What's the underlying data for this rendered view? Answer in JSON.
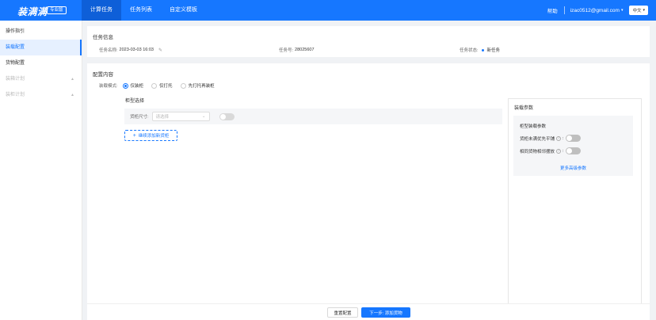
{
  "header": {
    "logo": "装满满",
    "edition": "专业版",
    "tabs": [
      {
        "label": "计算任务",
        "active": true
      },
      {
        "label": "任务列表",
        "active": false
      },
      {
        "label": "自定义模板",
        "active": false
      }
    ],
    "help": "帮助",
    "user_email": "izac0512@gmail.com",
    "language": "中文",
    "accent_color": "#1677ff"
  },
  "sidebar": {
    "items": [
      {
        "label": "操作指引",
        "state": "normal"
      },
      {
        "label": "装载配置",
        "state": "active"
      },
      {
        "label": "货物配置",
        "state": "normal"
      },
      {
        "label": "装箱计划",
        "state": "disabled"
      },
      {
        "label": "装柜计划",
        "state": "disabled"
      }
    ]
  },
  "task_info": {
    "title": "任务信息",
    "name_label": "任务名称:",
    "name_value": "2023-03-03 16:03",
    "number_label": "任务号:",
    "number_value": "28025607",
    "status_label": "任务状态:",
    "status_value": "新任务"
  },
  "config": {
    "title": "配置内容",
    "mode_label": "装载模式:",
    "modes": [
      {
        "label": "仅装柜",
        "checked": true
      },
      {
        "label": "仅打托",
        "checked": false
      },
      {
        "label": "先打托再装柜",
        "checked": false
      }
    ],
    "container_select_title": "柜型选择",
    "size_label": "货柜尺寸:",
    "size_placeholder": "请选择",
    "add_button": "继续添加新货柜"
  },
  "params": {
    "title": "装载参数",
    "sub_title": "柜型装载参数",
    "option1_label": "货柜未满优先平铺",
    "option2_label": "相同货物相邻摆放",
    "more_link": "更多高级参数"
  },
  "footer": {
    "reset": "重置配置",
    "next": "下一步: 添加货物"
  }
}
